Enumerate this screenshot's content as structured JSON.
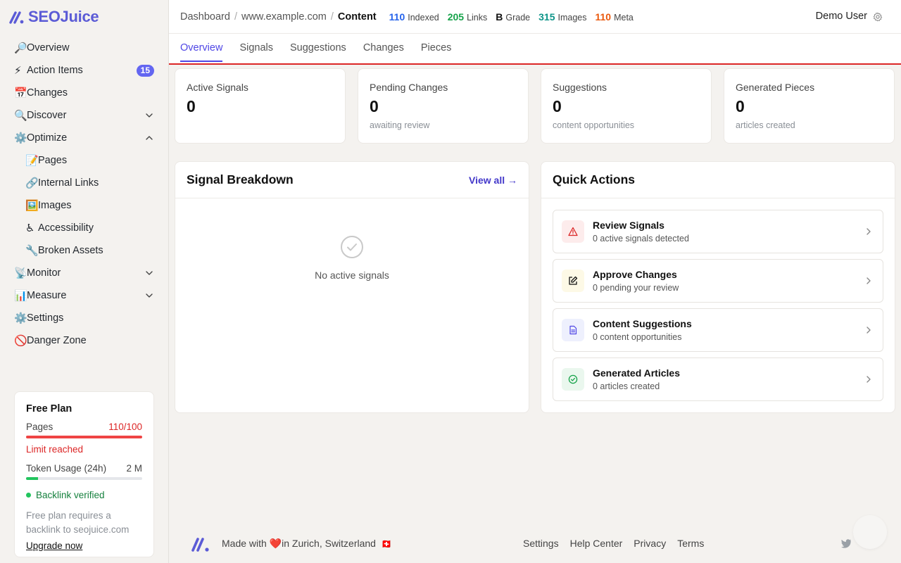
{
  "brand": {
    "name": "SEOJuice",
    "accent": "#5b5bd6"
  },
  "sidebar": {
    "items": [
      {
        "emoji": "🔎",
        "label": "Overview"
      },
      {
        "emoji": "⚡",
        "label": "Action Items",
        "badge": "15"
      },
      {
        "emoji": "📅",
        "label": "Changes"
      },
      {
        "emoji": "🔍",
        "label": "Discover",
        "chevron": "down"
      },
      {
        "emoji": "⚙️",
        "label": "Optimize",
        "chevron": "up"
      },
      {
        "emoji": "📝",
        "label": "Pages",
        "sub": true
      },
      {
        "emoji": "🔗",
        "label": "Internal Links",
        "sub": true
      },
      {
        "emoji": "🖼️",
        "label": "Images",
        "sub": true
      },
      {
        "emoji": "♿",
        "label": "Accessibility",
        "sub": true
      },
      {
        "emoji": "🔧",
        "label": "Broken Assets",
        "sub": true
      },
      {
        "emoji": "📡",
        "label": "Monitor",
        "chevron": "down"
      },
      {
        "emoji": "📊",
        "label": "Measure",
        "chevron": "down"
      },
      {
        "emoji": "⚙️",
        "label": "Settings"
      },
      {
        "emoji": "🚫",
        "label": "Danger Zone"
      }
    ]
  },
  "plan": {
    "title": "Free Plan",
    "pages_label": "Pages",
    "pages_value": "110/100",
    "pages_fraction": 1.0,
    "limit_text": "Limit reached",
    "token_label": "Token Usage (24h)",
    "token_value": "2 M",
    "token_fraction": 0.1,
    "verified_text": "Backlink verified",
    "note": "Free plan requires a backlink to seojuice.com",
    "upgrade": "Upgrade now"
  },
  "header": {
    "breadcrumb": [
      "Dashboard",
      "www.example.com",
      "Content"
    ],
    "stats": [
      {
        "value": "110",
        "label": "Indexed",
        "color": "#2563eb"
      },
      {
        "value": "205",
        "label": "Links",
        "color": "#16a34a"
      },
      {
        "value": "B",
        "label": "Grade",
        "color": "#111111"
      },
      {
        "value": "315",
        "label": "Images",
        "color": "#0d9488"
      },
      {
        "value": "110",
        "label": "Meta",
        "color": "#ea580c"
      }
    ],
    "user": "Demo User"
  },
  "tabs": [
    {
      "label": "Overview",
      "active": true
    },
    {
      "label": "Signals"
    },
    {
      "label": "Suggestions"
    },
    {
      "label": "Changes"
    },
    {
      "label": "Pieces"
    }
  ],
  "stat_cards": [
    {
      "title": "Active Signals",
      "value": "0",
      "sub": ""
    },
    {
      "title": "Pending Changes",
      "value": "0",
      "sub": "awaiting review"
    },
    {
      "title": "Suggestions",
      "value": "0",
      "sub": "content opportunities"
    },
    {
      "title": "Generated Pieces",
      "value": "0",
      "sub": "articles created"
    }
  ],
  "signal_breakdown": {
    "title": "Signal Breakdown",
    "view_all": "View all →",
    "empty": "No active signals"
  },
  "quick_actions": {
    "title": "Quick Actions",
    "items": [
      {
        "title": "Review Signals",
        "sub": "0 active signals detected",
        "icon": "alert-triangle-icon",
        "bg": "#fdecec",
        "color": "#dc2626"
      },
      {
        "title": "Approve Changes",
        "sub": "0 pending your review",
        "icon": "edit-icon",
        "bg": "#fdf9e6",
        "color": "#111111"
      },
      {
        "title": "Content Suggestions",
        "sub": "0 content opportunities",
        "icon": "document-icon",
        "bg": "#eef0fd",
        "color": "#4f46e5"
      },
      {
        "title": "Generated Articles",
        "sub": "0 articles created",
        "icon": "check-circle-icon",
        "bg": "#eaf7ee",
        "color": "#16a34a"
      }
    ]
  },
  "footer": {
    "made_prefix": "Made with",
    "heart": "❤️",
    "made_suffix": "in Zurich, Switzerland",
    "flag": "🇨🇭",
    "links": [
      "Settings",
      "Help Center",
      "Privacy",
      "Terms"
    ]
  }
}
